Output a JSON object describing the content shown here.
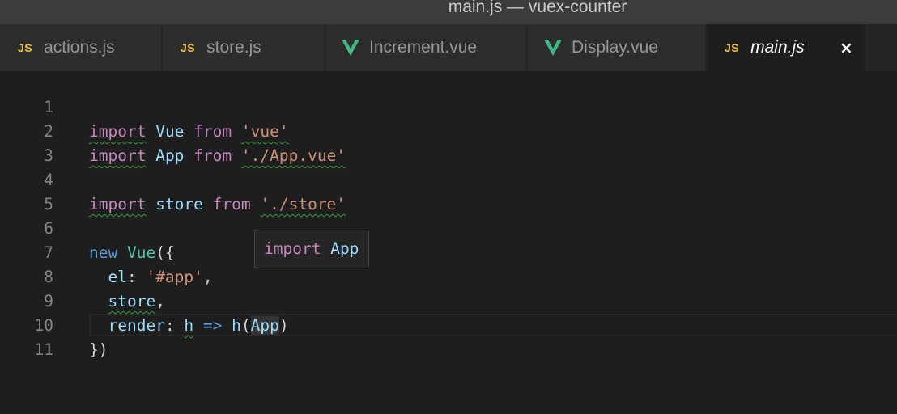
{
  "window": {
    "title": "main.js — vuex-counter"
  },
  "tabs": [
    {
      "label": "actions.js",
      "icon": "JS",
      "icon_type": "js",
      "active": false
    },
    {
      "label": "store.js",
      "icon": "JS",
      "icon_type": "js",
      "active": false
    },
    {
      "label": "Increment.vue",
      "icon_type": "vue",
      "active": false
    },
    {
      "label": "Display.vue",
      "icon_type": "vue",
      "active": false
    },
    {
      "label": "main.js",
      "icon": "JS",
      "icon_type": "js",
      "active": true,
      "close": "×"
    }
  ],
  "editor": {
    "line_numbers": [
      "1",
      "2",
      "3",
      "4",
      "5",
      "6",
      "7",
      "8",
      "9",
      "10",
      "11"
    ],
    "lines": {
      "l1": {
        "kw": "import",
        "name": "Vue",
        "from": "from",
        "str": "'vue'"
      },
      "l2": {
        "kw": "import",
        "name": "App",
        "from": "from",
        "str": "'./App.vue'"
      },
      "l4": {
        "kw": "import",
        "name": "store",
        "from": "from",
        "str": "'./store'"
      },
      "l6": {
        "kw": "new",
        "cls": "Vue",
        "punc": "({"
      },
      "l7": {
        "key": "el",
        "colon": ": ",
        "str": "'#app'",
        "comma": ","
      },
      "l8": {
        "key": "store",
        "comma": ","
      },
      "l9": {
        "key": "render",
        "colon": ": ",
        "param": "h",
        "arrow": "=>",
        "fn": "h",
        "open": "(",
        "arg": "App",
        "close": ")"
      },
      "l10": {
        "punc": "})"
      }
    }
  },
  "tooltip": {
    "kw": "import",
    "name": "App"
  },
  "colors": {
    "keyword": "#c586c0",
    "string": "#ce9178",
    "variable": "#9cdcfe",
    "class": "#4ec9b0",
    "js_icon": "#e8c23c",
    "vue_icon": "#41b883"
  }
}
